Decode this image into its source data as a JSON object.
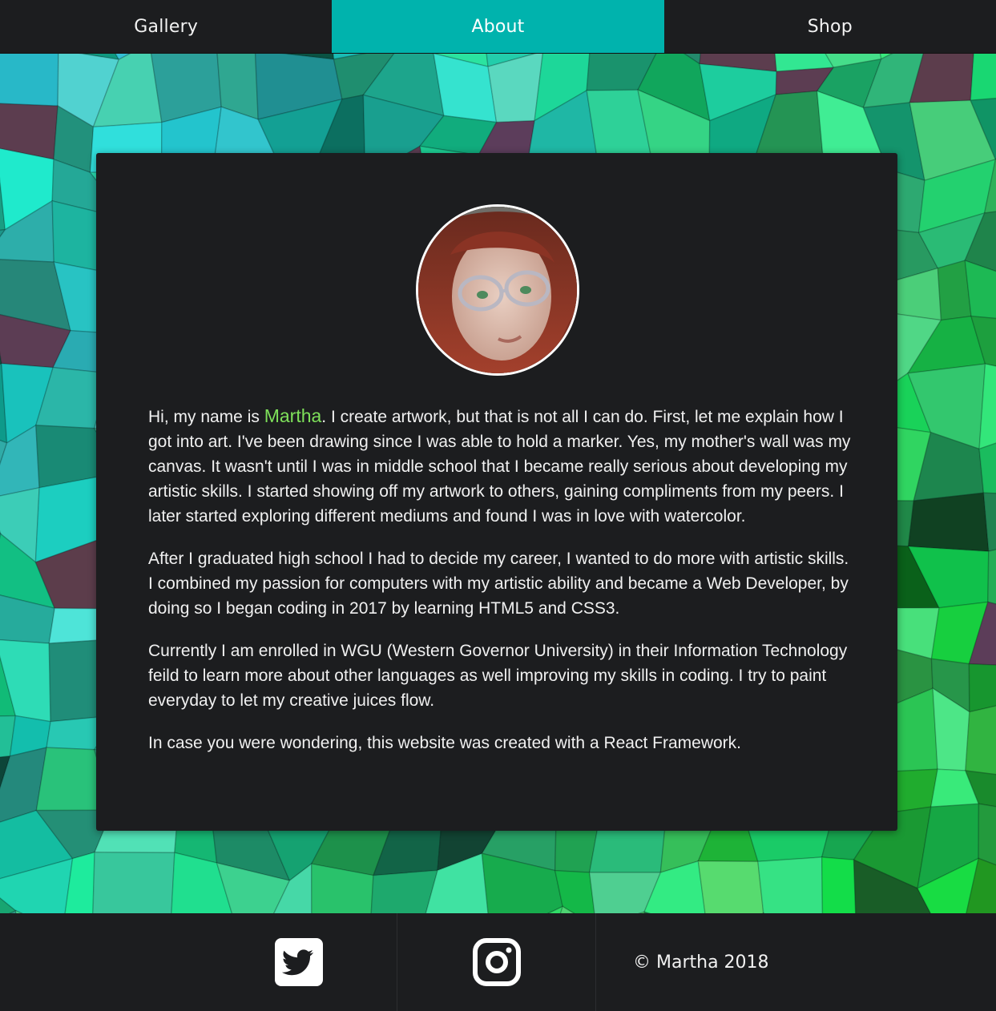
{
  "nav": {
    "tabs": [
      {
        "label": "Gallery",
        "active": false
      },
      {
        "label": "About",
        "active": true
      },
      {
        "label": "Shop",
        "active": false
      }
    ],
    "active_color": "#00b3ad"
  },
  "about": {
    "intro_before": "Hi, my name is ",
    "name": "Martha",
    "intro_after": ". I create artwork, but that is not all I can do. First, let me explain how I got into art. I've been drawing since I was able to hold a marker. Yes, my mother's wall was my canvas. It wasn't until I was in middle school that I became really serious about developing my artistic skills. I started showing off my artwork to others, gaining compliments from my peers. I later started exploring different mediums and found I was in love with watercolor.",
    "paragraph2": "After I graduated high school I had to decide my career, I wanted to do more with artistic skills. I combined my passion for computers with my artistic ability and became a Web Developer, by doing so I began coding in 2017 by learning HTML5 and CSS3.",
    "paragraph3": "Currently I am enrolled in WGU (Western Governor University) in their Information Technology feild to learn more about other languages as well improving my skills in coding. I try to paint everyday to let my creative juices flow.",
    "paragraph4": "In case you were wondering, this website was created with a React Framework.",
    "name_color": "#7ee05a"
  },
  "footer": {
    "icons": [
      "twitter-icon",
      "instagram-icon"
    ],
    "copyright": "© Martha 2018"
  }
}
